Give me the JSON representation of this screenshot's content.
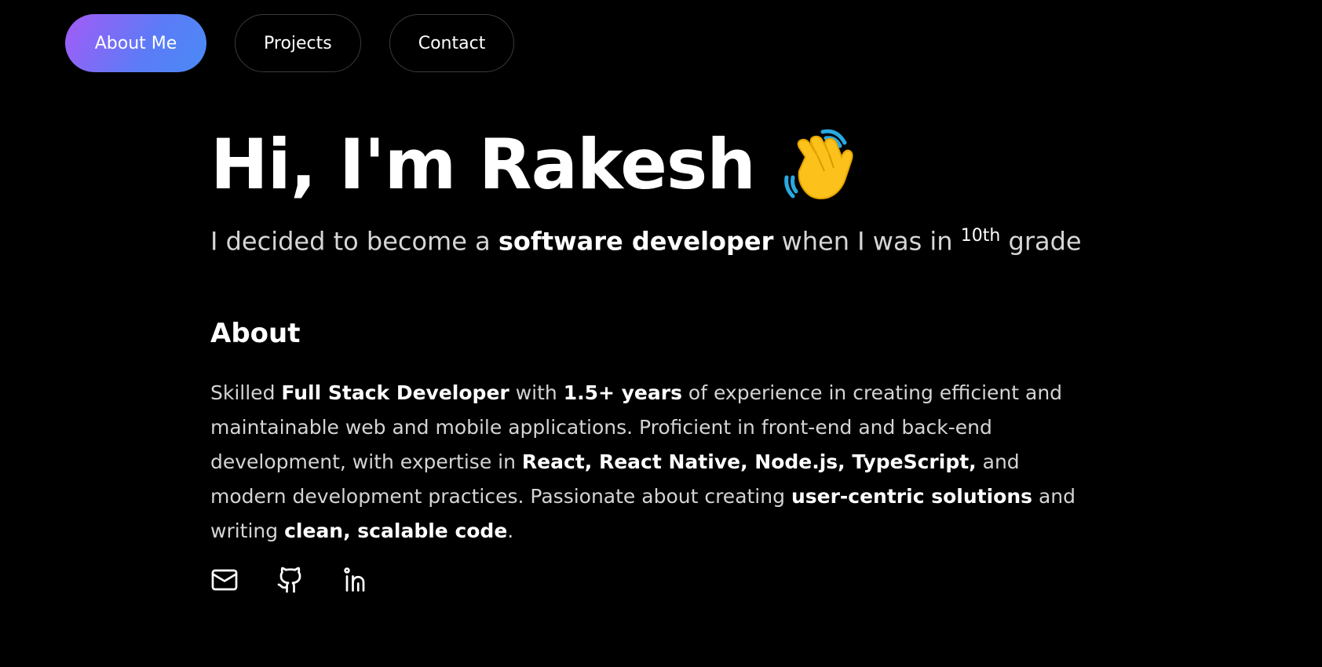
{
  "nav": {
    "items": [
      {
        "label": "About Me",
        "active": true
      },
      {
        "label": "Projects",
        "active": false
      },
      {
        "label": "Contact",
        "active": false
      }
    ],
    "active_gradient": [
      "#a35bf5",
      "#4a8af5"
    ]
  },
  "hero": {
    "title": "Hi, I'm Rakesh",
    "wave_icon": "waving-hand-icon",
    "subtitle_prefix": "I decided to become a",
    "subtitle_strong": "software developer",
    "subtitle_mid": "when I was in",
    "subtitle_sup": "10th",
    "subtitle_suffix": "grade"
  },
  "about": {
    "heading": "About",
    "t1": "Skilled",
    "b1": "Full Stack Developer",
    "t2": "with",
    "b2": "1.5+ years",
    "t3": "of experience in creating efficient and maintainable web and mobile applications. Proficient in front-end and back-end development, with expertise in",
    "b3": "React, React Native, Node.js, TypeScript,",
    "t4": "and modern development practices. Passionate about creating",
    "b4": "user-centric solutions",
    "t5": "and writing",
    "b5": "clean, scalable code",
    "t6": "."
  },
  "socials": [
    {
      "icon": "mail-icon"
    },
    {
      "icon": "github-icon"
    },
    {
      "icon": "linkedin-icon"
    }
  ]
}
